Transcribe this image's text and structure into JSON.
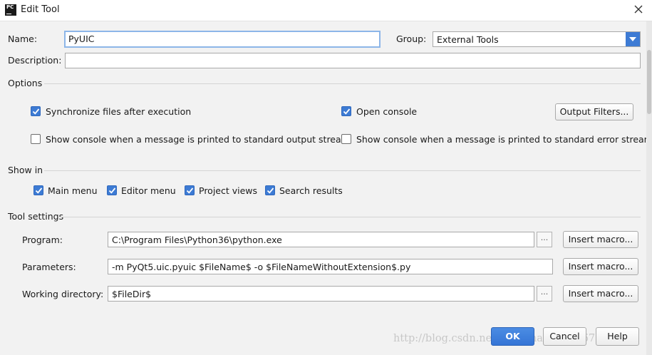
{
  "window": {
    "title": "Edit Tool",
    "icon_text": "PC"
  },
  "name_field": {
    "label": "Name:",
    "value": "PyUIC"
  },
  "group_field": {
    "label": "Group:",
    "value": "External Tools"
  },
  "description_field": {
    "label": "Description:",
    "value": ""
  },
  "options": {
    "title": "Options",
    "sync_files": {
      "label": "Synchronize files after execution",
      "checked": true
    },
    "open_console": {
      "label": "Open console",
      "checked": true
    },
    "output_filters_button": "Output Filters...",
    "show_console_stdout": {
      "label": "Show console when a message is printed to standard output stream",
      "checked": false
    },
    "show_console_stderr": {
      "label": "Show console when a message is printed to standard error stream",
      "checked": false
    }
  },
  "show_in": {
    "title": "Show in",
    "items": [
      {
        "label": "Main menu",
        "checked": true
      },
      {
        "label": "Editor menu",
        "checked": true
      },
      {
        "label": "Project views",
        "checked": true
      },
      {
        "label": "Search results",
        "checked": true
      }
    ]
  },
  "tool_settings": {
    "title": "Tool settings",
    "program": {
      "label": "Program:",
      "value": "C:\\Program Files\\Python36\\python.exe"
    },
    "parameters": {
      "label": "Parameters:",
      "value": "-m PyQt5.uic.pyuic  $FileName$ -o $FileNameWithoutExtension$.py"
    },
    "working_directory": {
      "label": "Working directory:",
      "value": "$FileDir$"
    },
    "browse_label": "...",
    "insert_macro_label": "Insert macro..."
  },
  "footer": {
    "ok": "OK",
    "cancel": "Cancel",
    "help": "Help",
    "watermark": "http://blog.csdn.net/chaochao2653067"
  },
  "colors": {
    "accent": "#3d7bd4",
    "focus_ring": "#8db6e8",
    "background": "#f2f2f2"
  },
  "icons": [
    "close-icon",
    "dropdown-arrow-icon",
    "checkmark-icon"
  ]
}
